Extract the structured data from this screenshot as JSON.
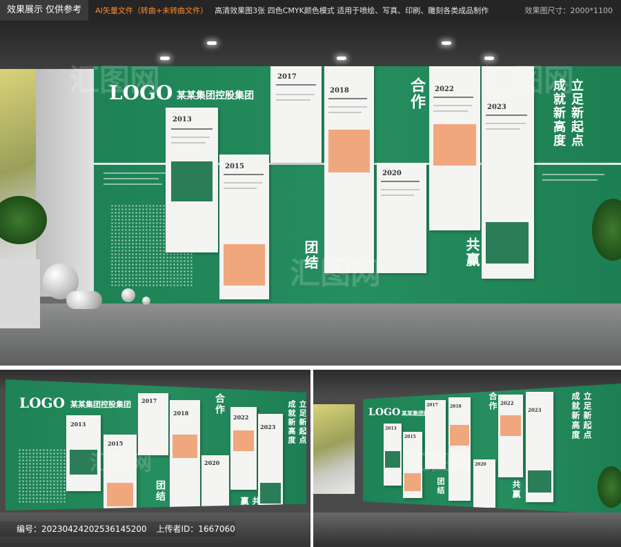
{
  "banner": {
    "disclaimer": "效果展示 仅供参考",
    "file_type": "AI矢量文件（转曲+未转曲文件）",
    "description": "高清效果图3张  四色CMYK颜色模式 适用于喷绘、写真、印刷、雕刻各类成品制作",
    "size": "效果图尺寸：2000*1100"
  },
  "wall": {
    "logo": "LOGO",
    "company": "某某集团控股集团",
    "slogan_right": "立足新起点 成就新高度",
    "slogan_left": "团结",
    "slogan_mid": "合作",
    "slogan_bottom": "共赢",
    "years": [
      "2013",
      "2015",
      "2017",
      "2018",
      "2020",
      "2022",
      "2023"
    ],
    "colors": {
      "wall_green": "#1f8a5a",
      "panel_white": "#f4f4f2",
      "accent_orange": "#f0a77d",
      "image_green": "#2a7d56"
    }
  },
  "watermark": "汇图网",
  "footer": {
    "code_label": "编号：20230424202536145200",
    "uploader_label": "上传者ID：1667060"
  }
}
